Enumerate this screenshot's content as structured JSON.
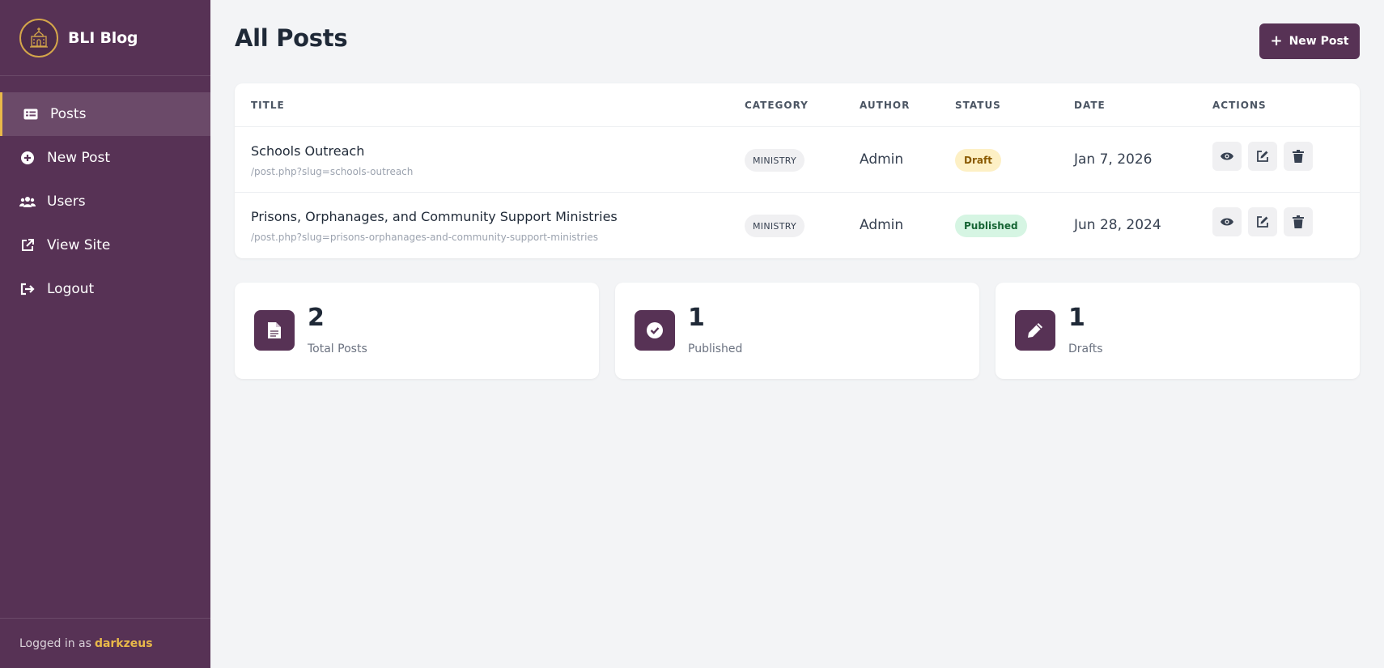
{
  "brand": {
    "name": "BLI Blog"
  },
  "nav": [
    {
      "label": "Posts",
      "icon": "list-icon",
      "active": true
    },
    {
      "label": "New Post",
      "icon": "plus-circle-icon"
    },
    {
      "label": "Users",
      "icon": "users-icon"
    },
    {
      "label": "View Site",
      "icon": "external-link-icon"
    },
    {
      "label": "Logout",
      "icon": "logout-icon"
    }
  ],
  "footer": {
    "prefix": "Logged in as",
    "username": "darkzeus"
  },
  "header": {
    "title": "All Posts",
    "new_post_label": "New Post"
  },
  "table": {
    "columns": [
      "TITLE",
      "CATEGORY",
      "AUTHOR",
      "STATUS",
      "DATE",
      "ACTIONS"
    ],
    "rows": [
      {
        "title": "Schools Outreach",
        "slug": "/post.php?slug=schools-outreach",
        "category": "MINISTRY",
        "author": "Admin",
        "status": "Draft",
        "date": "Jan 7, 2026"
      },
      {
        "title": "Prisons, Orphanages, and Community Support Ministries",
        "slug": "/post.php?slug=prisons-orphanages-and-community-support-ministries",
        "category": "MINISTRY",
        "author": "Admin",
        "status": "Published",
        "date": "Jun 28, 2024"
      }
    ]
  },
  "stats": [
    {
      "value": "2",
      "label": "Total Posts",
      "icon": "file-icon"
    },
    {
      "value": "1",
      "label": "Published",
      "icon": "check-circle-icon"
    },
    {
      "value": "1",
      "label": "Drafts",
      "icon": "pencil-icon"
    }
  ],
  "colors": {
    "sidebar": "#573255",
    "accent": "#e9b949",
    "primary": "#573255",
    "background": "#f3f4f6"
  }
}
